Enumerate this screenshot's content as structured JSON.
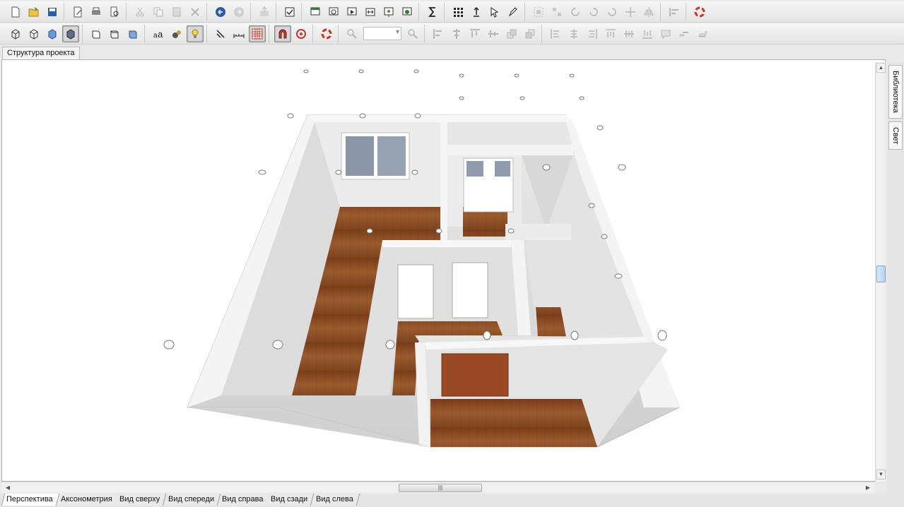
{
  "project_structure_tab": "Структура проекта",
  "side_tabs": [
    "Библиотека",
    "Свет"
  ],
  "view_tabs": [
    "Перспектива",
    "Аксонометрия",
    "Вид сверху",
    "Вид спереди",
    "Вид справа",
    "Вид сзади",
    "Вид слева"
  ],
  "active_view_tab": 0,
  "colors": {
    "floor": "#8a4a22",
    "wall": "#e8e8e8",
    "door": "#9a4a23",
    "accent_icon": "#c0392b"
  }
}
